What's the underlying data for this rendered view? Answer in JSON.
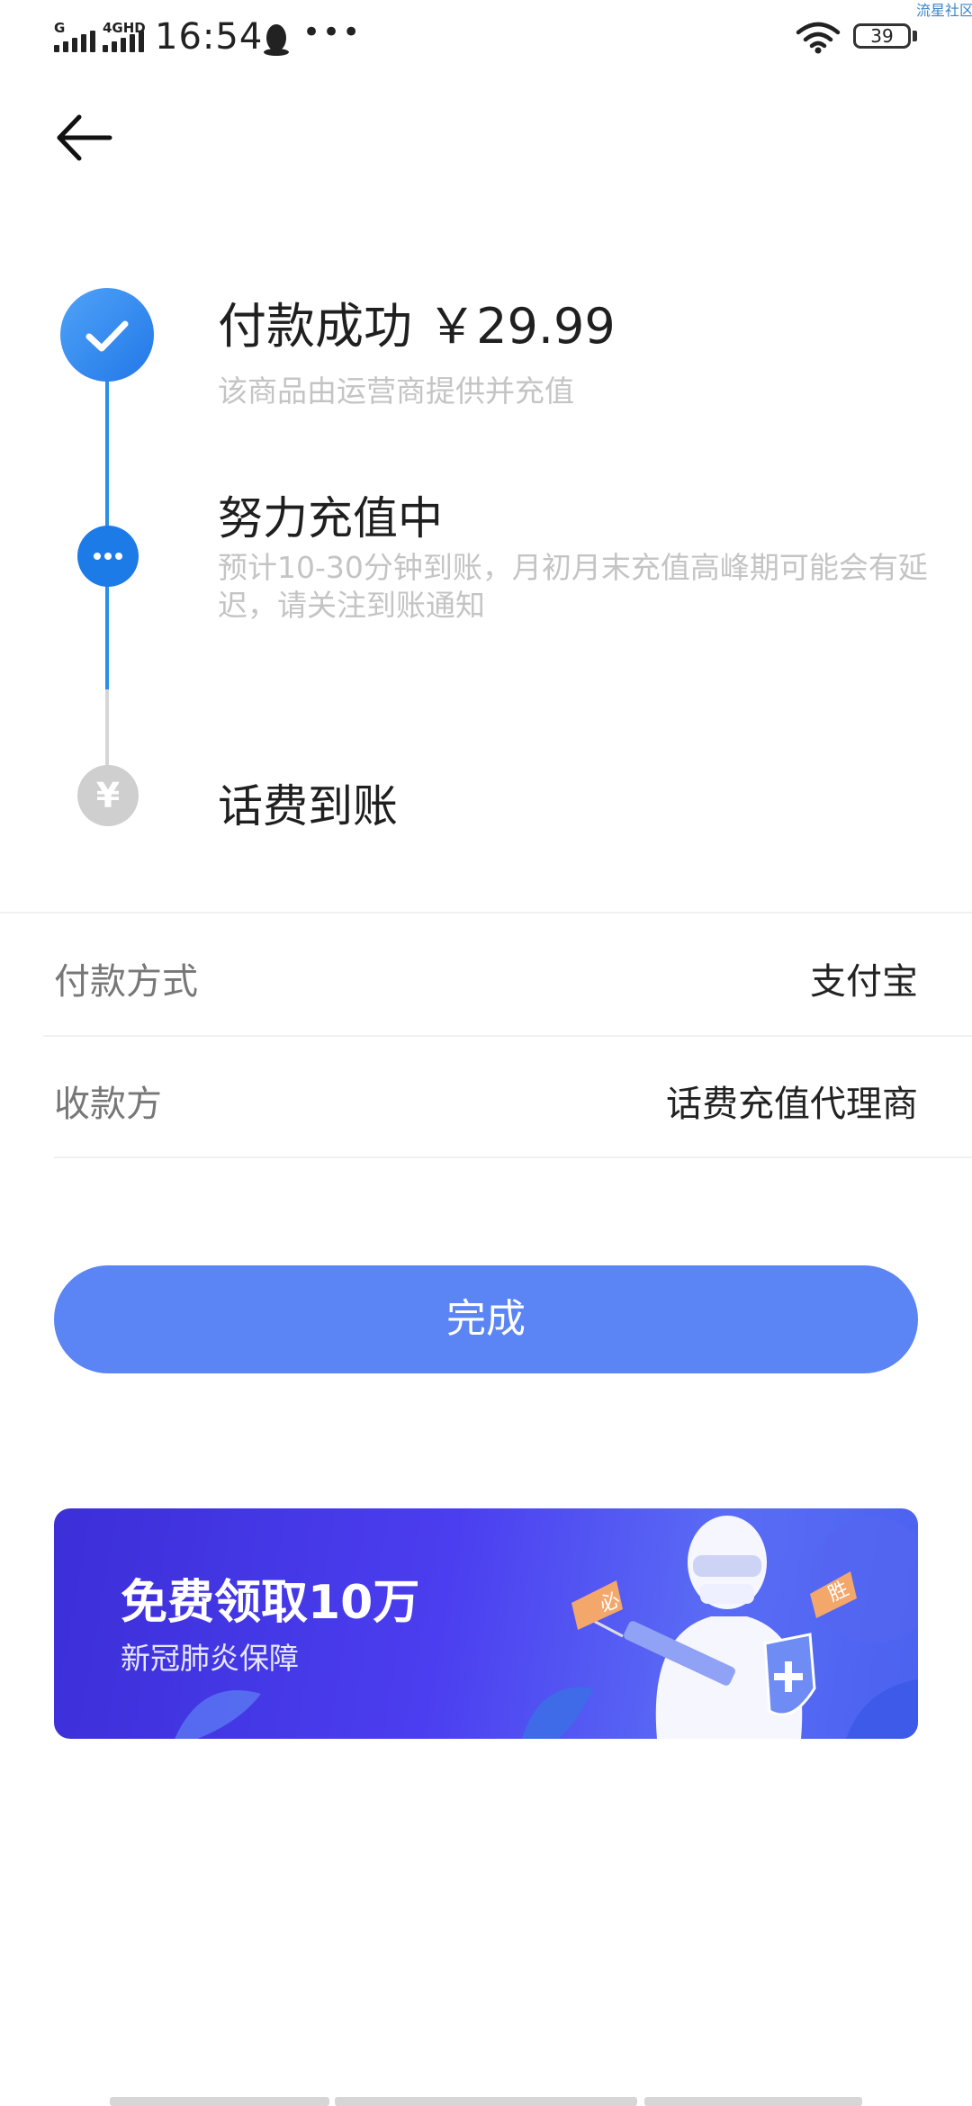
{
  "status_bar": {
    "signal1_label": "G",
    "signal2_label": "4GHD",
    "time": "16:54",
    "more": "•••",
    "battery": "39",
    "watermark": "流星社区"
  },
  "icons": {
    "back": "arrow-left-icon",
    "check": "check-icon",
    "progress": "ellipsis-icon",
    "currency": "yuan-icon",
    "qq": "qq-penguin-icon",
    "wifi": "wifi-icon"
  },
  "steps": [
    {
      "title": "付款成功 ￥29.99",
      "subtitle": "该商品由运营商提供并充值",
      "state": "done"
    },
    {
      "title": "努力充值中",
      "subtitle": "预计10-30分钟到账，月初月末充值高峰期可能会有延迟，请关注到账通知",
      "state": "active"
    },
    {
      "title": "话费到账",
      "icon_glyph": "¥",
      "state": "pending"
    }
  ],
  "info": {
    "payment_method_label": "付款方式",
    "payment_method_value": "支付宝",
    "payee_label": "收款方",
    "payee_value": "话费充值代理商"
  },
  "done_button": "完成",
  "banner": {
    "title": "免费领取10万",
    "subtitle": "新冠肺炎保障",
    "flag_left": "必",
    "flag_right": "胜"
  },
  "colors": {
    "accent_blue": "#2a8ee8",
    "button_blue": "#5b84f5",
    "banner_purple": "#3c2fd8",
    "pending_gray": "#cfcfcf"
  }
}
